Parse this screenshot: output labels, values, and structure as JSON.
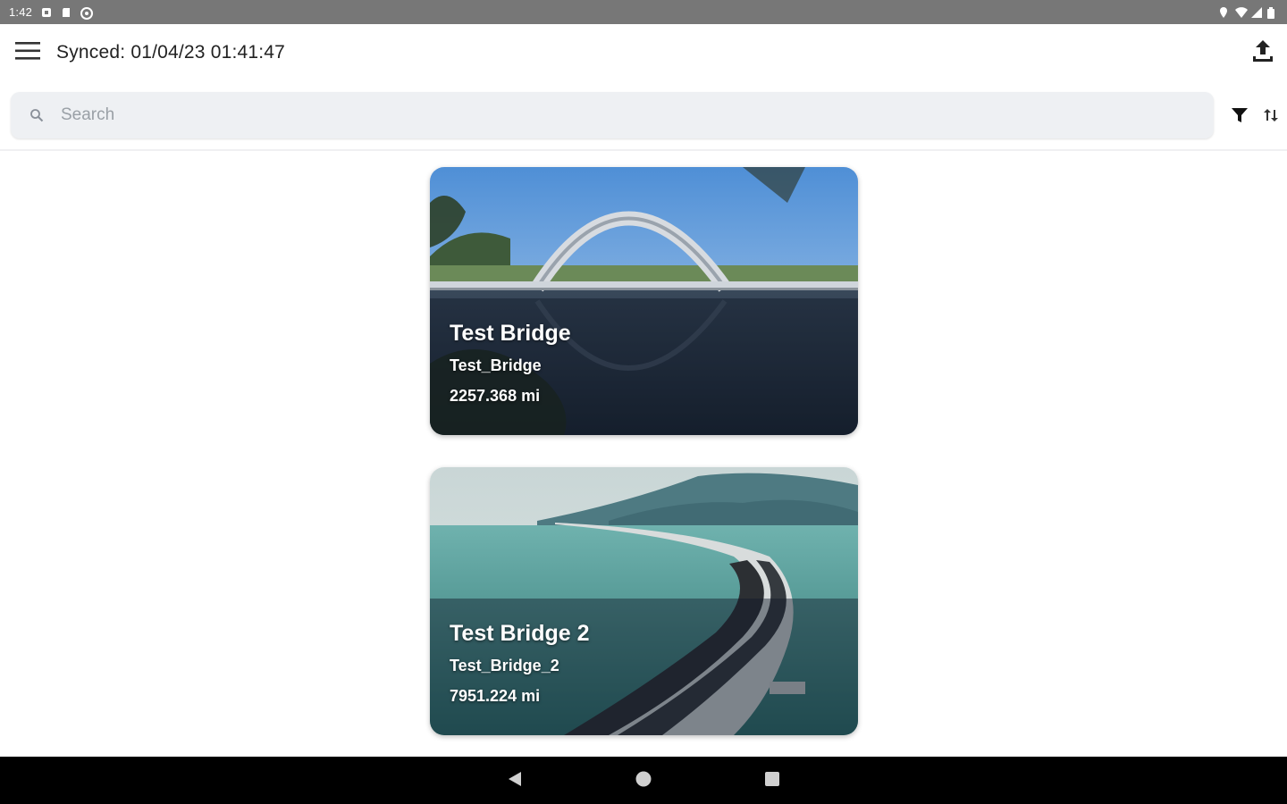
{
  "status_bar": {
    "time": "1:42",
    "icons": [
      "notification-icon",
      "sd-card-icon",
      "sync-status-icon"
    ],
    "right_icons": [
      "location-icon",
      "wifi-icon",
      "signal-icon",
      "battery-icon"
    ]
  },
  "app_bar": {
    "menu_icon": "menu-icon",
    "sync_title": "Synced: 01/04/23 01:41:47",
    "upload_icon": "upload-icon"
  },
  "search": {
    "placeholder": "Search",
    "value": "",
    "filter_icon": "filter-icon",
    "sort_icon": "sort-icon"
  },
  "bridges": [
    {
      "title": "Test Bridge",
      "subtitle": "Test_Bridge",
      "distance": "2257.368 mi"
    },
    {
      "title": "Test Bridge 2",
      "subtitle": "Test_Bridge_2",
      "distance": "7951.224 mi"
    }
  ],
  "nav_bar": {
    "icons": [
      "back-icon",
      "home-icon",
      "recent-apps-icon"
    ]
  },
  "colors": {
    "status_bar": "#777777",
    "search_bg": "#eef0f3",
    "nav_bar": "#000000"
  }
}
